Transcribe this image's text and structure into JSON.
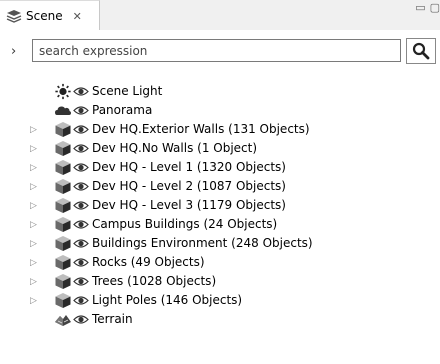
{
  "tab": {
    "label": "Scene",
    "close_glyph": "✕"
  },
  "window_buttons": {
    "minimize": "▭",
    "maximize": "▢"
  },
  "search": {
    "expander": "›",
    "placeholder": "search expression",
    "value": ""
  },
  "tree": [
    {
      "label": "Scene Light",
      "icon": "sun-icon",
      "expandable": false
    },
    {
      "label": "Panorama",
      "icon": "cloud-icon",
      "expandable": false
    },
    {
      "label": "Dev HQ.Exterior Walls (131 Objects)",
      "icon": "cube-icon",
      "expandable": true
    },
    {
      "label": "Dev HQ.No Walls (1 Object)",
      "icon": "cube-icon",
      "expandable": true
    },
    {
      "label": "Dev HQ - Level 1 (1320 Objects)",
      "icon": "cube-icon",
      "expandable": true
    },
    {
      "label": "Dev HQ - Level 2 (1087 Objects)",
      "icon": "cube-icon",
      "expandable": true
    },
    {
      "label": "Dev HQ - Level 3 (1179 Objects)",
      "icon": "cube-icon",
      "expandable": true
    },
    {
      "label": "Campus Buildings (24 Objects)",
      "icon": "cube-icon",
      "expandable": true
    },
    {
      "label": "Buildings Environment (248 Objects)",
      "icon": "cube-icon",
      "expandable": true
    },
    {
      "label": "Rocks (49 Objects)",
      "icon": "cube-icon",
      "expandable": true
    },
    {
      "label": "Trees (1028 Objects)",
      "icon": "cube-icon",
      "expandable": true
    },
    {
      "label": "Light Poles (146 Objects)",
      "icon": "cube-icon",
      "expandable": true
    },
    {
      "label": "Terrain",
      "icon": "terrain-icon",
      "expandable": false
    }
  ]
}
